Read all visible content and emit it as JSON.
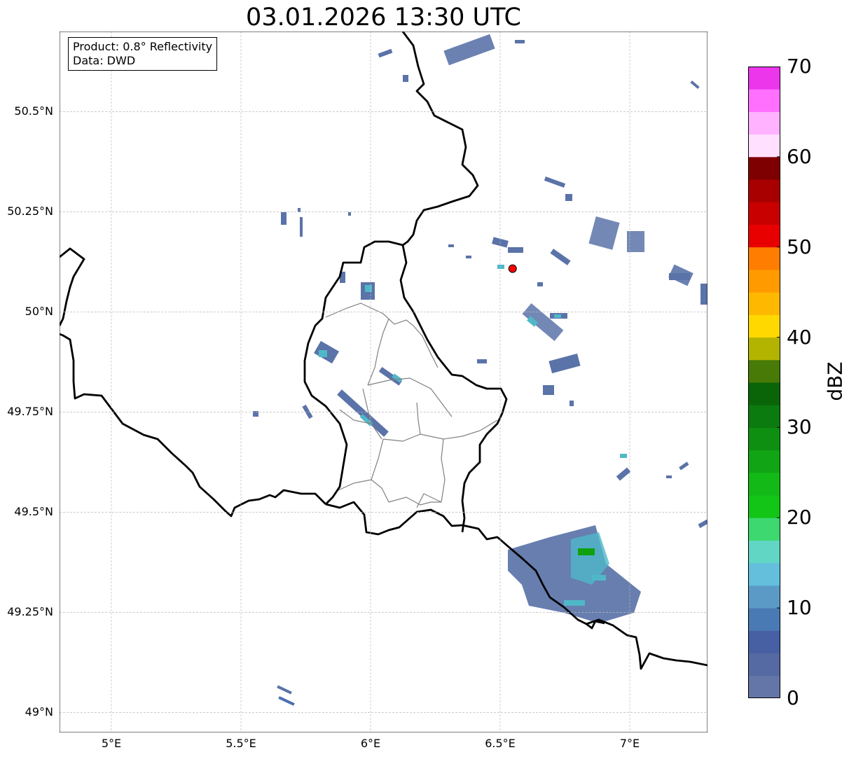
{
  "title": "03.01.2026 13:30 UTC",
  "info_box": {
    "product": "Product: 0.8° Reflectivity",
    "data": "Data: DWD"
  },
  "lat_labels": [
    "50.5°N",
    "50.25°N",
    "50°N",
    "49.75°N",
    "49.5°N",
    "49.25°N",
    "49°N"
  ],
  "lat_values": [
    50.5,
    50.25,
    50.0,
    49.75,
    49.5,
    49.25,
    49.0
  ],
  "lon_labels": [
    "5°E",
    "5.5°E",
    "6°E",
    "6.5°E",
    "7°E"
  ],
  "lon_values": [
    5.0,
    5.5,
    6.0,
    6.5,
    7.0
  ],
  "extent": {
    "lon_min": 4.8,
    "lon_max": 7.3,
    "lat_min": 48.95,
    "lat_max": 50.7
  },
  "marker": {
    "lon": 6.548,
    "lat": 50.108,
    "color": "#ff0000"
  },
  "colorbar": {
    "unit": "dBZ",
    "tick_labels": [
      "0",
      "10",
      "20",
      "30",
      "40",
      "50",
      "60",
      "70"
    ],
    "tick_values": [
      0,
      10,
      20,
      30,
      40,
      50,
      60,
      70
    ],
    "min": 0,
    "max": 70,
    "step": 2.5,
    "colors": [
      "#6475a8",
      "#5569a2",
      "#4760a3",
      "#4a7ab3",
      "#5b9ac6",
      "#64bfdd",
      "#61d6c4",
      "#3dd870",
      "#12c516",
      "#13b917",
      "#11a515",
      "#0f8f12",
      "#0c7b0f",
      "#0a6508",
      "#477a06",
      "#b2b400",
      "#ffd800",
      "#ffb800",
      "#ff9a00",
      "#ff7d00",
      "#e80000",
      "#c80000",
      "#a80000",
      "#7e0000",
      "#ffe0ff",
      "#ffb2ff",
      "#ff70ff",
      "#ec36ec"
    ]
  },
  "colors": {
    "country_border": "#000000",
    "admin_border": "#808080",
    "grid": "#bbbbbb",
    "echo_low": "#5a73a8",
    "echo_mid": "#4fb8c8",
    "echo_green": "#10a010"
  }
}
